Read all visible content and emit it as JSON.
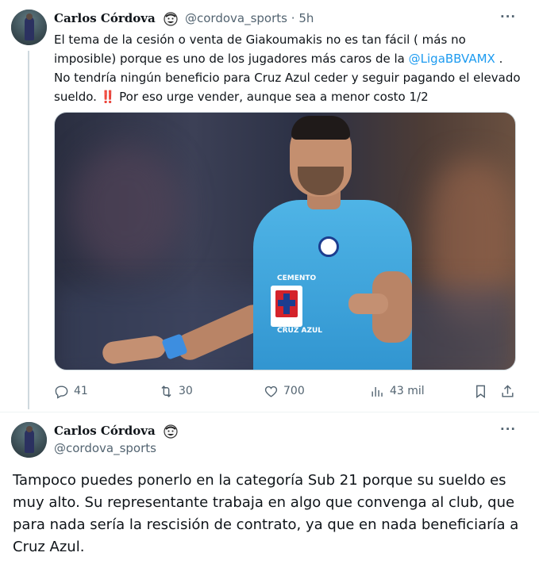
{
  "tweet1": {
    "name": "Carlos Córdova",
    "handle": "@cordova_sports",
    "separator": "·",
    "time": "5h",
    "more": "···",
    "text_part1": "El tema de la cesión o venta de Giakoumakis no es tan fácil ( más no imposible) porque es uno de los jugadores más caros de la ",
    "mention": "@LigaBBVAMX",
    "text_part2": " . No tendría ningún beneficio para Cruz Azul ceder y seguir pagando el elevado sueldo. ",
    "emoji": "‼️",
    "text_part3": " Por eso urge vender, aunque sea a menor costo 1/2",
    "media": {
      "jersey_text_top": "CEMENTO",
      "jersey_text_bottom": "CRUZ AZUL"
    },
    "actions": {
      "replies": "41",
      "retweets": "30",
      "likes": "700",
      "views": "43 mil"
    }
  },
  "tweet2": {
    "name": "Carlos Córdova",
    "handle": "@cordova_sports",
    "more": "···",
    "text": "Tampoco puedes ponerlo en la categoría Sub 21 porque su sueldo es muy alto. Su representante trabaja en algo que convenga al club, que para nada sería la rescisión de contrato, ya que en nada beneficiaría a Cruz Azul."
  },
  "icons": [
    "reply-icon",
    "retweet-icon",
    "like-icon",
    "views-icon",
    "bookmark-icon",
    "share-icon",
    "more-icon"
  ],
  "colors": {
    "accent": "#1d9bf0",
    "secondary_text": "#536471",
    "text": "#0f1419"
  }
}
